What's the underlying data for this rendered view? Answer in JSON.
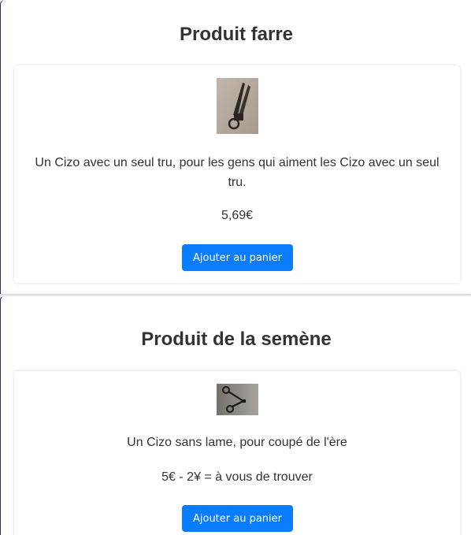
{
  "sections": [
    {
      "title": "Produit farre",
      "product": {
        "image_icon": "scissors-photo",
        "description": "Un Cizo avec un seul tru, pour les gens qui aiment les Cizo avec un seul tru.",
        "price": "5,69€",
        "button_label": "Ajouter au panier"
      }
    },
    {
      "title": "Produit de la semène",
      "product": {
        "image_icon": "scissors-photo",
        "description": "Un Cizo sans lame, pour coupé de l'ère",
        "price": "5€ - 2¥ = à vous de trouver",
        "button_label": "Ajouter au panier"
      }
    }
  ],
  "colors": {
    "button": "#0a7cff",
    "text": "#333333",
    "background": "#ffffff"
  }
}
